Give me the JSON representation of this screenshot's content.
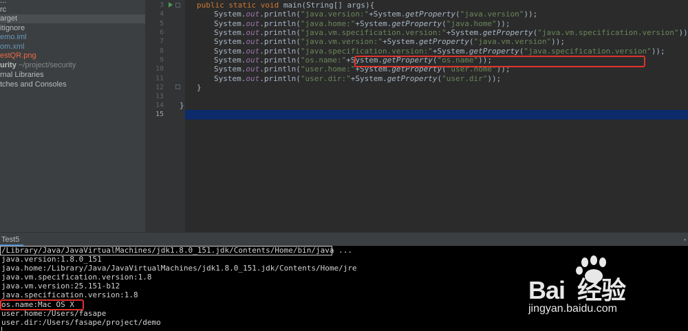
{
  "project": {
    "items": [
      {
        "text": "rc",
        "color": "default"
      },
      {
        "text": "arget",
        "color": "default",
        "selected": true
      },
      {
        "text": "itignore",
        "color": "default"
      },
      {
        "text": "emo.iml",
        "color": "blue"
      },
      {
        "text": "om.xml",
        "color": "blue"
      },
      {
        "text": "estQR.png",
        "color": "orange"
      },
      {
        "text": "urity",
        "path": "~/project/security",
        "color": "default",
        "bold": true
      },
      {
        "text": "rnal Libraries",
        "color": "default"
      },
      {
        "text": "tches and Consoles",
        "color": "default"
      }
    ]
  },
  "editor": {
    "line_numbers": [
      "3",
      "4",
      "5",
      "6",
      "7",
      "8",
      "9",
      "10",
      "11",
      "12",
      "13",
      "14",
      "15"
    ],
    "current_line": "15",
    "code": {
      "l3": {
        "a": "public static void ",
        "b": "main(String[] args){"
      },
      "l4": {
        "pre": "System.",
        "out": "out",
        "mid": ".println(",
        "s1": "\"java.version:\"",
        "plus": "+System.",
        "gp": "getProperty",
        "open": "(",
        "s2": "\"java.version\"",
        "end": "));"
      },
      "l5": {
        "pre": "System.",
        "out": "out",
        "mid": ".println(",
        "s1": "\"java.home:\"",
        "plus": "+System.",
        "gp": "getProperty",
        "open": "(",
        "s2": "\"java.home\"",
        "end": "));"
      },
      "l6": {
        "pre": "System.",
        "out": "out",
        "mid": ".println(",
        "s1": "\"java.vm.specification.version:\"",
        "plus": "+System.",
        "gp": "getProperty",
        "open": "(",
        "s2": "\"java.vm.specification.version\"",
        "end": "));"
      },
      "l7": {
        "pre": "System.",
        "out": "out",
        "mid": ".println(",
        "s1": "\"java.vm.version:\"",
        "plus": "+System.",
        "gp": "getProperty",
        "open": "(",
        "s2": "\"java.vm.version\"",
        "end": "));"
      },
      "l8": {
        "pre": "System.",
        "out": "out",
        "mid": ".println(",
        "s1": "\"java.specification.version:\"",
        "plus": "+System.",
        "gp": "getProperty",
        "open": "(",
        "s2": "\"java.specification.version\"",
        "end": "));"
      },
      "l9": {
        "pre": "System.",
        "out": "out",
        "mid": ".println(",
        "s1": "\"os.name:\"",
        "plus": "+System.",
        "gp": "getProperty",
        "open": "(",
        "s2": "\"os.name\"",
        "end": "));"
      },
      "l10": {
        "pre": "System.",
        "out": "out",
        "mid": ".println(",
        "s1": "\"user.home:\"",
        "plus": "+System.",
        "gp": "getProperty",
        "open": "(",
        "s2": "\"user.home\"",
        "end": "));"
      },
      "l11": {
        "pre": "System.",
        "out": "out",
        "mid": ".println(",
        "s1": "\"user.dir:\"",
        "plus": "+System.",
        "gp": "getProperty",
        "open": "(",
        "s2": "\"user.dir\"",
        "end": "));"
      },
      "l12": "}",
      "l14": "}"
    }
  },
  "run_panel": {
    "tab_label": "Test5"
  },
  "console": {
    "lines": [
      "/Library/Java/JavaVirtualMachines/jdk1.8.0_151.jdk/Contents/Home/bin/java ...",
      "java.version:1.8.0_151",
      "java.home:/Library/Java/JavaVirtualMachines/jdk1.8.0_151.jdk/Contents/Home/jre",
      "java.vm.specification.version:1.8",
      "java.vm.version:25.151-b12",
      "java.specification.version:1.8",
      "os.name:Mac OS X",
      "user.home:/Users/fasape",
      "user.dir:/Users/fasape/project/demo"
    ]
  },
  "watermark": {
    "logo": "Bai  经验",
    "url": "jingyan.baidu.com"
  },
  "colors": {
    "highlight_box": "#e0342c",
    "current_line": "#0d2a6b"
  }
}
